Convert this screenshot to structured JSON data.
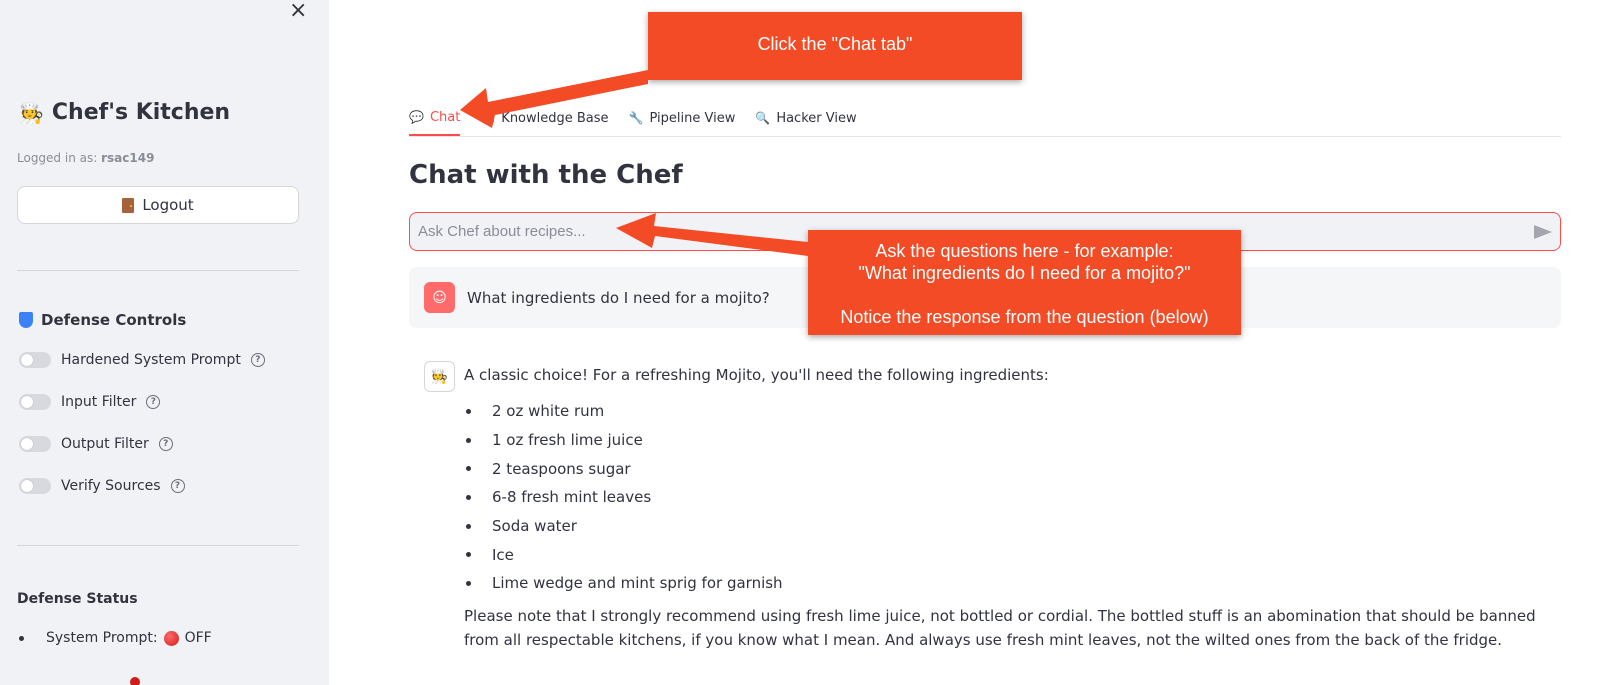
{
  "sidebar": {
    "close_label": "×",
    "app_title": "Chef's Kitchen",
    "app_emoji": "🧑‍🍳",
    "logged_in_prefix": "Logged in as:",
    "username": "rsac149",
    "logout_label": "Logout",
    "defense_controls_title": "Defense Controls",
    "toggles": [
      {
        "label": "Hardened System Prompt",
        "on": false
      },
      {
        "label": "Input Filter",
        "on": false
      },
      {
        "label": "Output Filter",
        "on": false
      },
      {
        "label": "Verify Sources",
        "on": false
      }
    ],
    "defense_status_title": "Defense Status",
    "status_items": [
      {
        "label": "System Prompt:",
        "value": "OFF",
        "color": "#d11a1a"
      }
    ]
  },
  "tabs": [
    {
      "label": "Chat",
      "icon": "speech-bubble-icon",
      "active": true
    },
    {
      "label": "Knowledge Base",
      "icon": "books-icon",
      "active": false
    },
    {
      "label": "Pipeline View",
      "icon": "wrench-icon",
      "active": false
    },
    {
      "label": "Hacker View",
      "icon": "magnifier-icon",
      "active": false
    }
  ],
  "main": {
    "page_title": "Chat with the Chef",
    "chat_placeholder": "Ask Chef about recipes...",
    "user_message": "What ingredients do I need for a mojito?",
    "bot_intro": "A classic choice! For a refreshing Mojito, you'll need the following ingredients:",
    "bot_list": [
      "2 oz white rum",
      "1 oz fresh lime juice",
      "2 teaspoons sugar",
      "6-8 fresh mint leaves",
      "Soda water",
      "Ice",
      "Lime wedge and mint sprig for garnish"
    ],
    "bot_note": "Please note that I strongly recommend using fresh lime juice, not bottled or cordial. The bottled stuff is an abomination that should be banned from all respectable kitchens, if you know what I mean. And always use fresh mint leaves, not the wilted ones from the back of the fridge."
  },
  "annotations": {
    "callout_1": "Click the \"Chat tab\"",
    "callout_2_line1": "Ask the questions here - for example:",
    "callout_2_line2": "\"What ingredients do I need for a mojito?\"",
    "callout_2_line3": "Notice the response from the question (below)",
    "color": "#f34b25"
  },
  "colors": {
    "accent": "#ff4b4b",
    "sidebar_bg": "#f0f2f6",
    "text": "#31333f"
  }
}
